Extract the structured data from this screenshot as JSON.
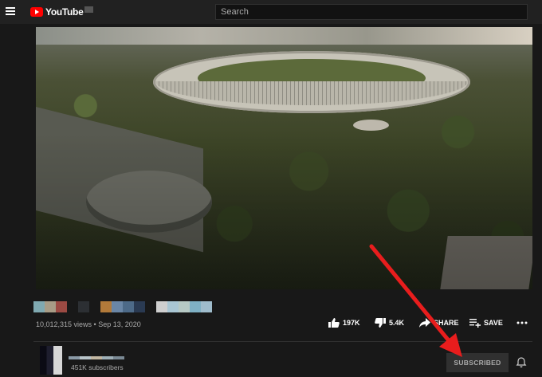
{
  "header": {
    "logo_text": "YouTube",
    "search_placeholder": "Search"
  },
  "video": {
    "meta": "10,012,315 views • Sep 13, 2020",
    "actions": {
      "like_count": "197K",
      "dislike_count": "5.4K",
      "share_label": "SHARE",
      "save_label": "SAVE"
    }
  },
  "channel": {
    "subscribers": "451K subscribers",
    "subscribe_label": "SUBSCRIBED"
  },
  "icons": {
    "menu": "hamburger-icon",
    "like": "thumbs-up-icon",
    "dislike": "thumbs-down-icon",
    "share": "share-arrow-icon",
    "save": "playlist-add-icon",
    "more": "more-dots-icon",
    "bell": "bell-icon"
  },
  "colors": {
    "accent": "#ff0000",
    "annotation_arrow": "#e81d1d"
  }
}
